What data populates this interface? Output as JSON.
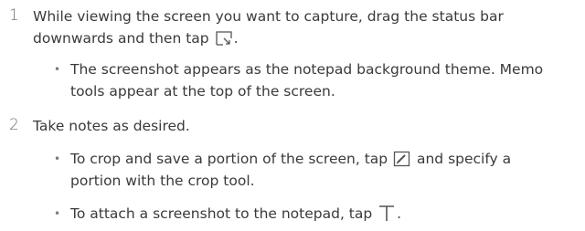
{
  "steps": [
    {
      "number": "1",
      "line1_before_icon": "While viewing the screen you want to capture, drag the status bar",
      "line2_before_icon": "downwards and then tap",
      "line2_after_icon": ".",
      "icon": "screen-capture-icon",
      "bullets": [
        {
          "line1": "The screenshot appears as the notepad background theme. Memo",
          "line2": "tools appear at the top of the screen."
        }
      ]
    },
    {
      "number": "2",
      "text": "Take notes as desired.",
      "bullets": [
        {
          "line1_before_icon": "To crop and save a portion of the screen, tap",
          "line1_after_icon": "and specify a",
          "line2": "portion with the crop tool.",
          "icon": "crop-icon"
        },
        {
          "before_icon": "To attach a screenshot to the notepad, tap",
          "after_icon": ".",
          "icon": "text-tool-icon"
        }
      ]
    }
  ],
  "bullet_glyph": "•"
}
